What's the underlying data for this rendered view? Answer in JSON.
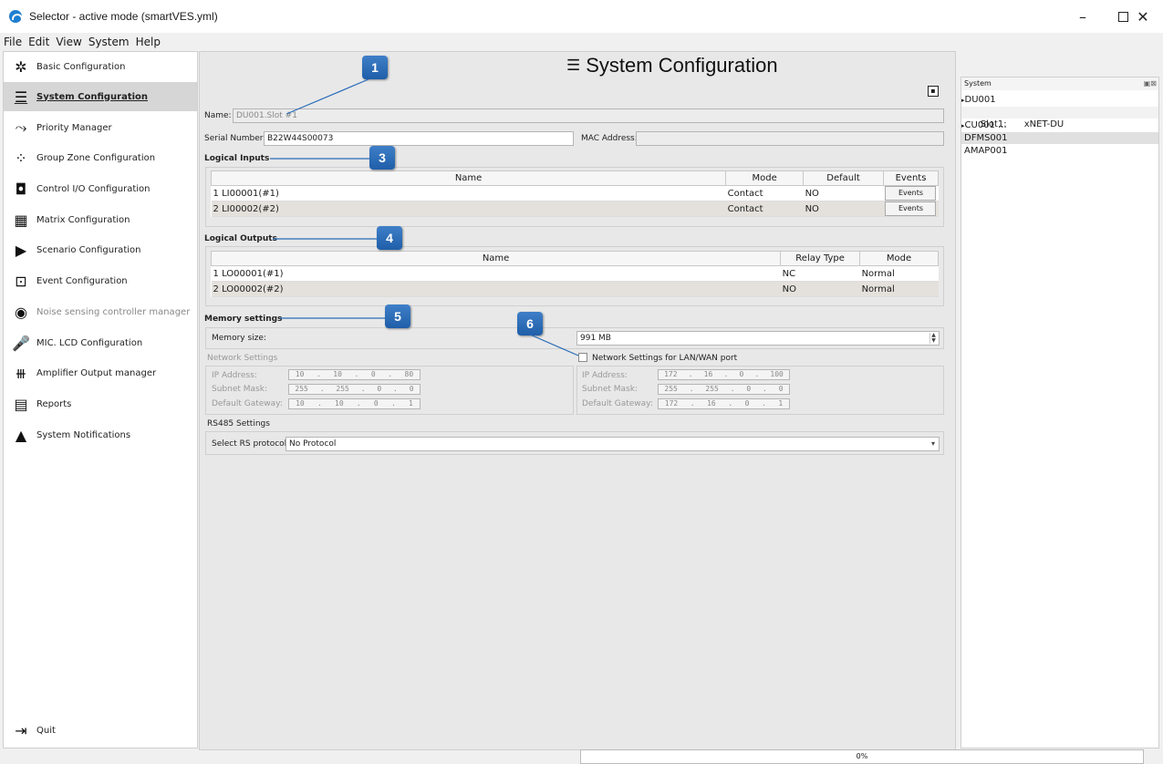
{
  "window": {
    "title": "Selector - active mode (smartVES.yml)",
    "minimize_glyph": "–",
    "close_glyph": "✕"
  },
  "menu": [
    "File",
    "Edit",
    "View",
    "System",
    "Help"
  ],
  "sidebar": {
    "items": [
      {
        "label": "Basic Configuration",
        "icon": "gear-icon",
        "glyph": "✲"
      },
      {
        "label": "System Configuration",
        "icon": "server-stack-icon",
        "glyph": "☰",
        "active": true
      },
      {
        "label": "Priority Manager",
        "icon": "priority-arrow-icon",
        "glyph": "⤳"
      },
      {
        "label": "Group Zone Configuration",
        "icon": "group-zone-icon",
        "glyph": "⁘"
      },
      {
        "label": "Control I/O Configuration",
        "icon": "control-io-icon",
        "glyph": "◘"
      },
      {
        "label": "Matrix Configuration",
        "icon": "matrix-grid-icon",
        "glyph": "▦"
      },
      {
        "label": "Scenario Configuration",
        "icon": "scenario-play-icon",
        "glyph": "▶"
      },
      {
        "label": "Event Configuration",
        "icon": "event-icon",
        "glyph": "⊡"
      },
      {
        "label": "Noise sensing controller manager",
        "icon": "noise-sensor-icon",
        "glyph": "◉",
        "disabled": true
      },
      {
        "label": "MIC. LCD Configuration",
        "icon": "microphone-icon",
        "glyph": "🎤"
      },
      {
        "label": "Amplifier Output manager",
        "icon": "amplifier-icon",
        "glyph": "⧻"
      },
      {
        "label": "Reports",
        "icon": "document-icon",
        "glyph": "▤"
      },
      {
        "label": "System Notifications",
        "icon": "warning-icon",
        "glyph": "▲"
      }
    ],
    "quit_label": "Quit",
    "quit_glyph": "⇥"
  },
  "main": {
    "title": "System Configuration",
    "title_icon_glyph": "☰",
    "name_label": "Name:",
    "name_value": "DU001.Slot #1",
    "serial_label": "Serial Number:",
    "serial_value": "B22W44S00073",
    "mac_label": "MAC Address:",
    "mac_value": "",
    "logical_inputs": {
      "title": "Logical Inputs",
      "columns": [
        "Name",
        "Mode",
        "Default",
        "Events"
      ],
      "rows": [
        {
          "num": "1",
          "name": "LI00001(#1)",
          "mode": "Contact",
          "default": "NO",
          "events": "Events"
        },
        {
          "num": "2",
          "name": "LI00002(#2)",
          "mode": "Contact",
          "default": "NO",
          "events": "Events"
        }
      ]
    },
    "logical_outputs": {
      "title": "Logical Outputs",
      "columns": [
        "Name",
        "Relay Type",
        "Mode"
      ],
      "rows": [
        {
          "num": "1",
          "name": "LO00001(#1)",
          "relay": "NC",
          "mode": "Normal"
        },
        {
          "num": "2",
          "name": "LO00002(#2)",
          "relay": "NO",
          "mode": "Normal"
        }
      ]
    },
    "memory": {
      "title": "Memory settings",
      "size_label": "Memory size:",
      "size_value": "991 MB"
    },
    "network": {
      "title": "Network Settings",
      "lan_checkbox_label": "Network Settings for LAN/WAN port",
      "ip_label": "IP Address:",
      "mask_label": "Subnet Mask:",
      "gateway_label": "Default Gateway:",
      "left": {
        "ip": [
          "10",
          "10",
          "0",
          "80"
        ],
        "mask": [
          "255",
          "255",
          "0",
          "0"
        ],
        "gateway": [
          "10",
          "10",
          "0",
          "1"
        ]
      },
      "right": {
        "ip": [
          "172",
          "16",
          "0",
          "100"
        ],
        "mask": [
          "255",
          "255",
          "0",
          "0"
        ],
        "gateway": [
          "172",
          "16",
          "0",
          "1"
        ]
      }
    },
    "rs485": {
      "title": "RS485 Settings",
      "protocol_label": "Select RS protocol:",
      "protocol_value": "No Protocol"
    }
  },
  "callouts": [
    "1",
    "3",
    "4",
    "5",
    "6"
  ],
  "system_panel": {
    "title": "System",
    "header_icons": "▣⊠",
    "tree": [
      {
        "label": "DU001",
        "expander": "▸"
      },
      {
        "label": "Slot1:      xNET-DU",
        "indent": true
      },
      {
        "label": "CU001 ...",
        "expander": "▸"
      },
      {
        "label": "DFMS001",
        "selected": true
      },
      {
        "label": "AMAP001"
      }
    ]
  },
  "status": {
    "progress_text": "0%",
    "progress_value": 0
  },
  "colors": {
    "callout": "#2a6cb8",
    "accent": "#1f7fd1"
  }
}
